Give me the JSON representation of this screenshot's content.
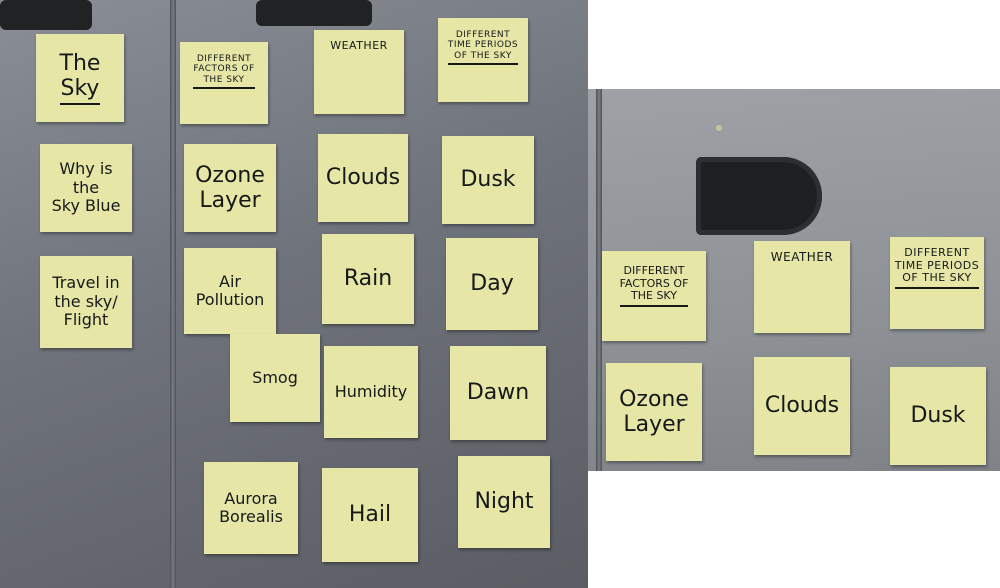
{
  "left_photo": {
    "col1": [
      "The\nSky",
      "Why is the\nSky Blue",
      "Travel in\nthe sky/\nFlight"
    ],
    "col2": [
      "DIFFERENT\nFACTORS OF\nTHE SKY",
      "Ozone\nLayer",
      "Air\nPollution",
      "Smog",
      "Aurora\nBorealis"
    ],
    "col3": [
      "WEATHER",
      "Clouds",
      "Rain",
      "Humidity",
      "Hail"
    ],
    "col4": [
      "DIFFERENT\nTIME PERIODS\nOF THE SKY",
      "Dusk",
      "Day",
      "Dawn",
      "Night"
    ]
  },
  "right_photo": {
    "notes": [
      "DIFFERENT\nFACTORS OF\nTHE SKY",
      "WEATHER",
      "DIFFERENT\nTIME PERIODS\nOF THE SKY",
      "Ozone\nLayer",
      "Clouds",
      "Dusk"
    ]
  },
  "colors": {
    "sticky_note": "#e6e7a6",
    "wall": "#7a7e85",
    "ink": "#16181a"
  }
}
